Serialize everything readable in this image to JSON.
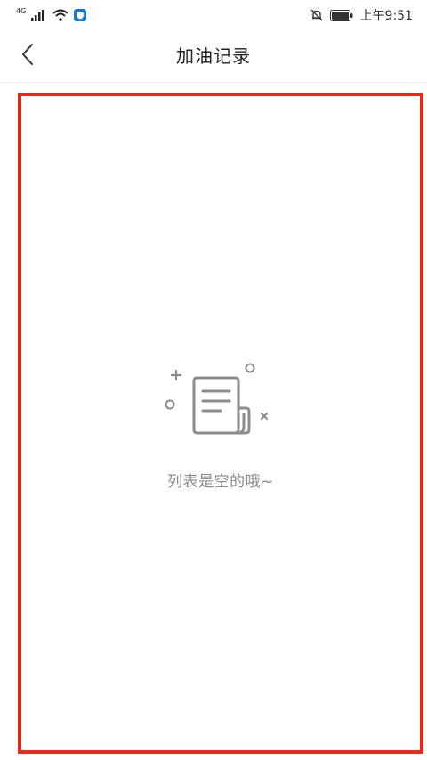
{
  "status_bar": {
    "network_type": "4G",
    "time": "上午9:51",
    "icons": [
      "signal-icon",
      "wifi-icon",
      "shield-app-icon",
      "mute-bell-icon",
      "battery-icon"
    ]
  },
  "header": {
    "back_icon": "chevron-left-icon",
    "title": "加油记录"
  },
  "content": {
    "empty_icon": "document-scroll-icon",
    "empty_text": "列表是空的哦~",
    "highlight_border_color": "#e62b1e"
  },
  "colors": {
    "background": "#ffffff",
    "title_text": "#222222",
    "empty_text": "#8a8a8a",
    "icon_gray": "#8c8c8c"
  }
}
